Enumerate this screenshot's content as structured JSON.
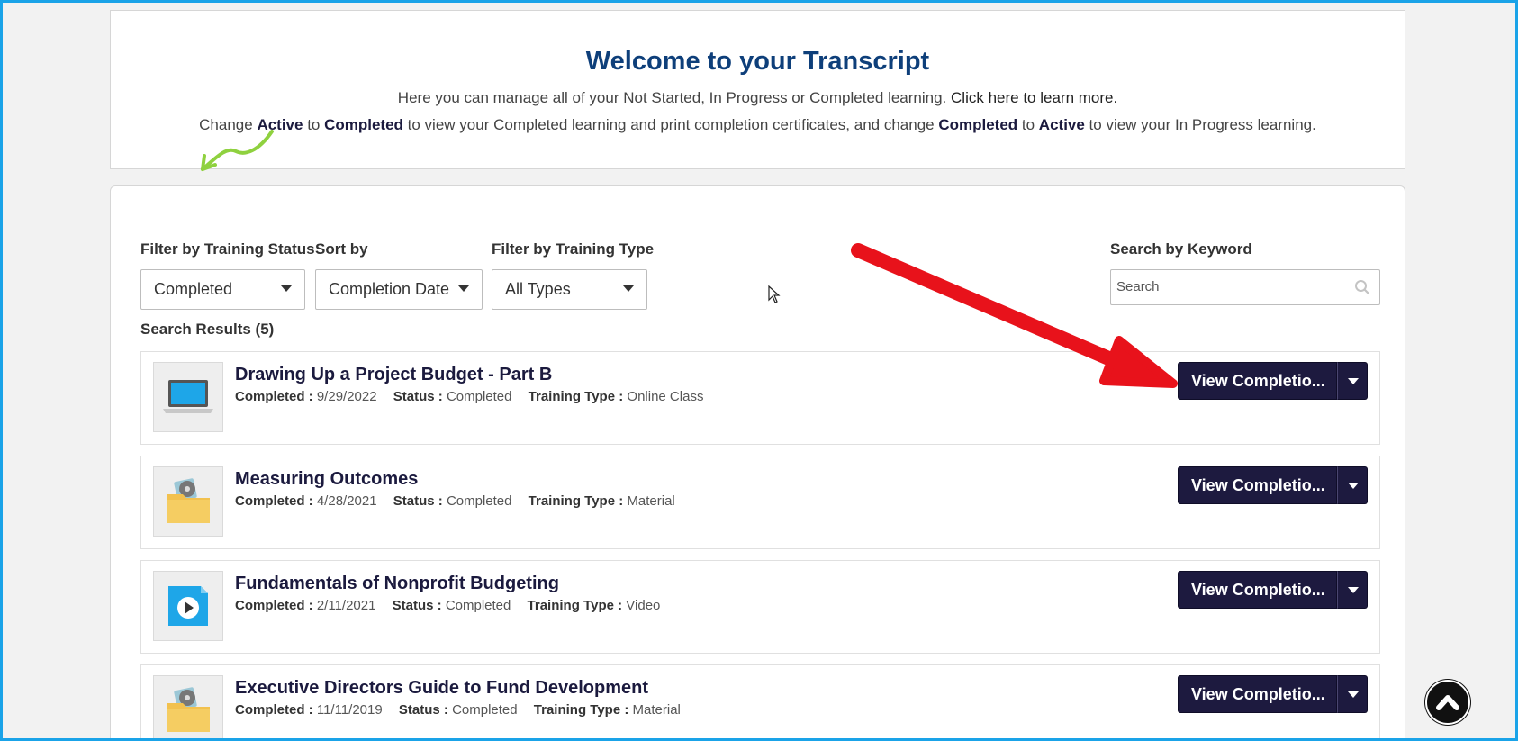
{
  "welcome": {
    "title": "Welcome to your Transcript",
    "line1_text": "Here you can manage all of your Not Started, In Progress or Completed learning. ",
    "line1_link": "Click here to learn more.",
    "line2": {
      "t1": "Change ",
      "b1": "Active",
      "t2": " to ",
      "b2": "Completed",
      "t3": " to view your Completed learning and print completion certificates, and change ",
      "b3": "Completed",
      "t4": " to ",
      "b4": "Active",
      "t5": " to view your In Progress learning."
    }
  },
  "filters": {
    "status_label": "Filter by Training Status",
    "status_value": "Completed",
    "sort_label": "Sort by",
    "sort_value": "Completion Date",
    "type_label": "Filter by Training Type",
    "type_value": "All Types",
    "search_label": "Search by Keyword",
    "search_placeholder": "Search"
  },
  "results_label": "Search Results (5)",
  "meta_labels": {
    "completed": "Completed :",
    "status": "Status :",
    "type": "Training Type :"
  },
  "results": [
    {
      "title": "Drawing Up a Project Budget - Part B",
      "completed": "9/29/2022",
      "status": "Completed",
      "type": "Online Class",
      "icon": "laptop-icon",
      "button": "View Completio..."
    },
    {
      "title": "Measuring Outcomes",
      "completed": "4/28/2021",
      "status": "Completed",
      "type": "Material",
      "icon": "folder-icon",
      "button": "View Completio..."
    },
    {
      "title": "Fundamentals of Nonprofit Budgeting",
      "completed": "2/11/2021",
      "status": "Completed",
      "type": "Video",
      "icon": "video-icon",
      "button": "View Completio..."
    },
    {
      "title": "Executive Directors Guide to Fund Development",
      "completed": "11/11/2019",
      "status": "Completed",
      "type": "Material",
      "icon": "folder-icon",
      "button": "View Completio..."
    }
  ],
  "colors": {
    "border_accent": "#1aa3e8",
    "title_blue": "#0e3f7a",
    "button_dark": "#1d1a3f",
    "annotation_red": "#e8121b",
    "annotation_green": "#8fd13f"
  }
}
